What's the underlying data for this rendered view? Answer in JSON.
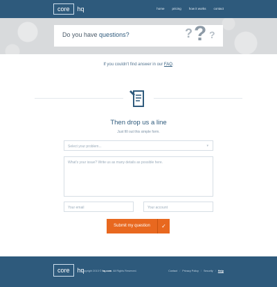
{
  "header": {
    "logo_core": "core",
    "logo_hq": "hq",
    "nav": [
      "home",
      "pricing",
      "how it works",
      "contact"
    ]
  },
  "hero": {
    "title_prefix": "Do you have ",
    "title_highlight": "questions?",
    "question_marks": "?"
  },
  "faq": {
    "prefix": "If you couldn't find answer in our ",
    "link": "FAQ",
    "suffix": "."
  },
  "form": {
    "heading": "Then drop us a line",
    "subheading": "Just fill out this simple form.",
    "select_placeholder": "Select your problem...",
    "textarea_placeholder": "What's your issue? Write us as many details as possible here.",
    "email_placeholder": "Your email",
    "account_placeholder": "Your account",
    "submit_label": "Submit my question",
    "submit_icon": "✓"
  },
  "footer": {
    "logo_core": "core",
    "logo_hq": "hq",
    "copyright_prefix": "Copyright 2013 © ",
    "copyright_brand": "hq.com",
    "copyright_suffix": ". All Rights Reserved.",
    "links": [
      "Contact",
      "Privacy Policy",
      "Security",
      "Help"
    ],
    "active_link": "Help"
  },
  "colors": {
    "brand_blue": "#2e5a7c",
    "accent_orange": "#e8681f"
  },
  "icons": {
    "document": "document-edit-icon",
    "select_arrow": "chevron-down-icon",
    "submit": "check-icon"
  }
}
